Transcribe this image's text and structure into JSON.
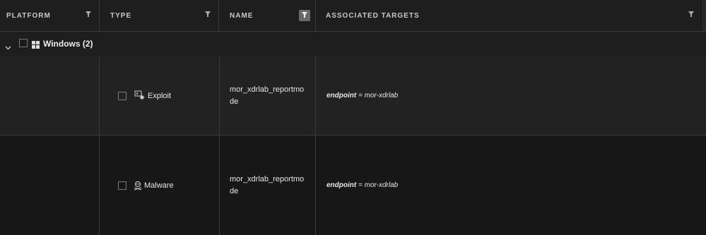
{
  "columns": [
    {
      "label": "PLATFORM"
    },
    {
      "label": "TYPE"
    },
    {
      "label": "NAME"
    },
    {
      "label": "ASSOCIATED TARGETS"
    }
  ],
  "group": {
    "label": "Windows (2)",
    "icon": "windows-icon"
  },
  "rows": [
    {
      "type": "Exploit",
      "type_icon": "exploit-icon",
      "name": "mor_xdrlab_reportmo",
      "name_cont": "de",
      "target_key": "endpoint",
      "target_op": " = ",
      "target_value": "mor-xdrlab"
    },
    {
      "type": "Malware",
      "type_icon": "malware-icon",
      "name": "mor_xdrlab_reportmo",
      "name_cont": "de",
      "target_key": "endpoint",
      "target_op": " = ",
      "target_value": "mor-xdrlab"
    }
  ],
  "colors": {
    "background": "#1b1b1b",
    "border": "#3a3a3a",
    "active_filter": "#6a6a6a"
  }
}
